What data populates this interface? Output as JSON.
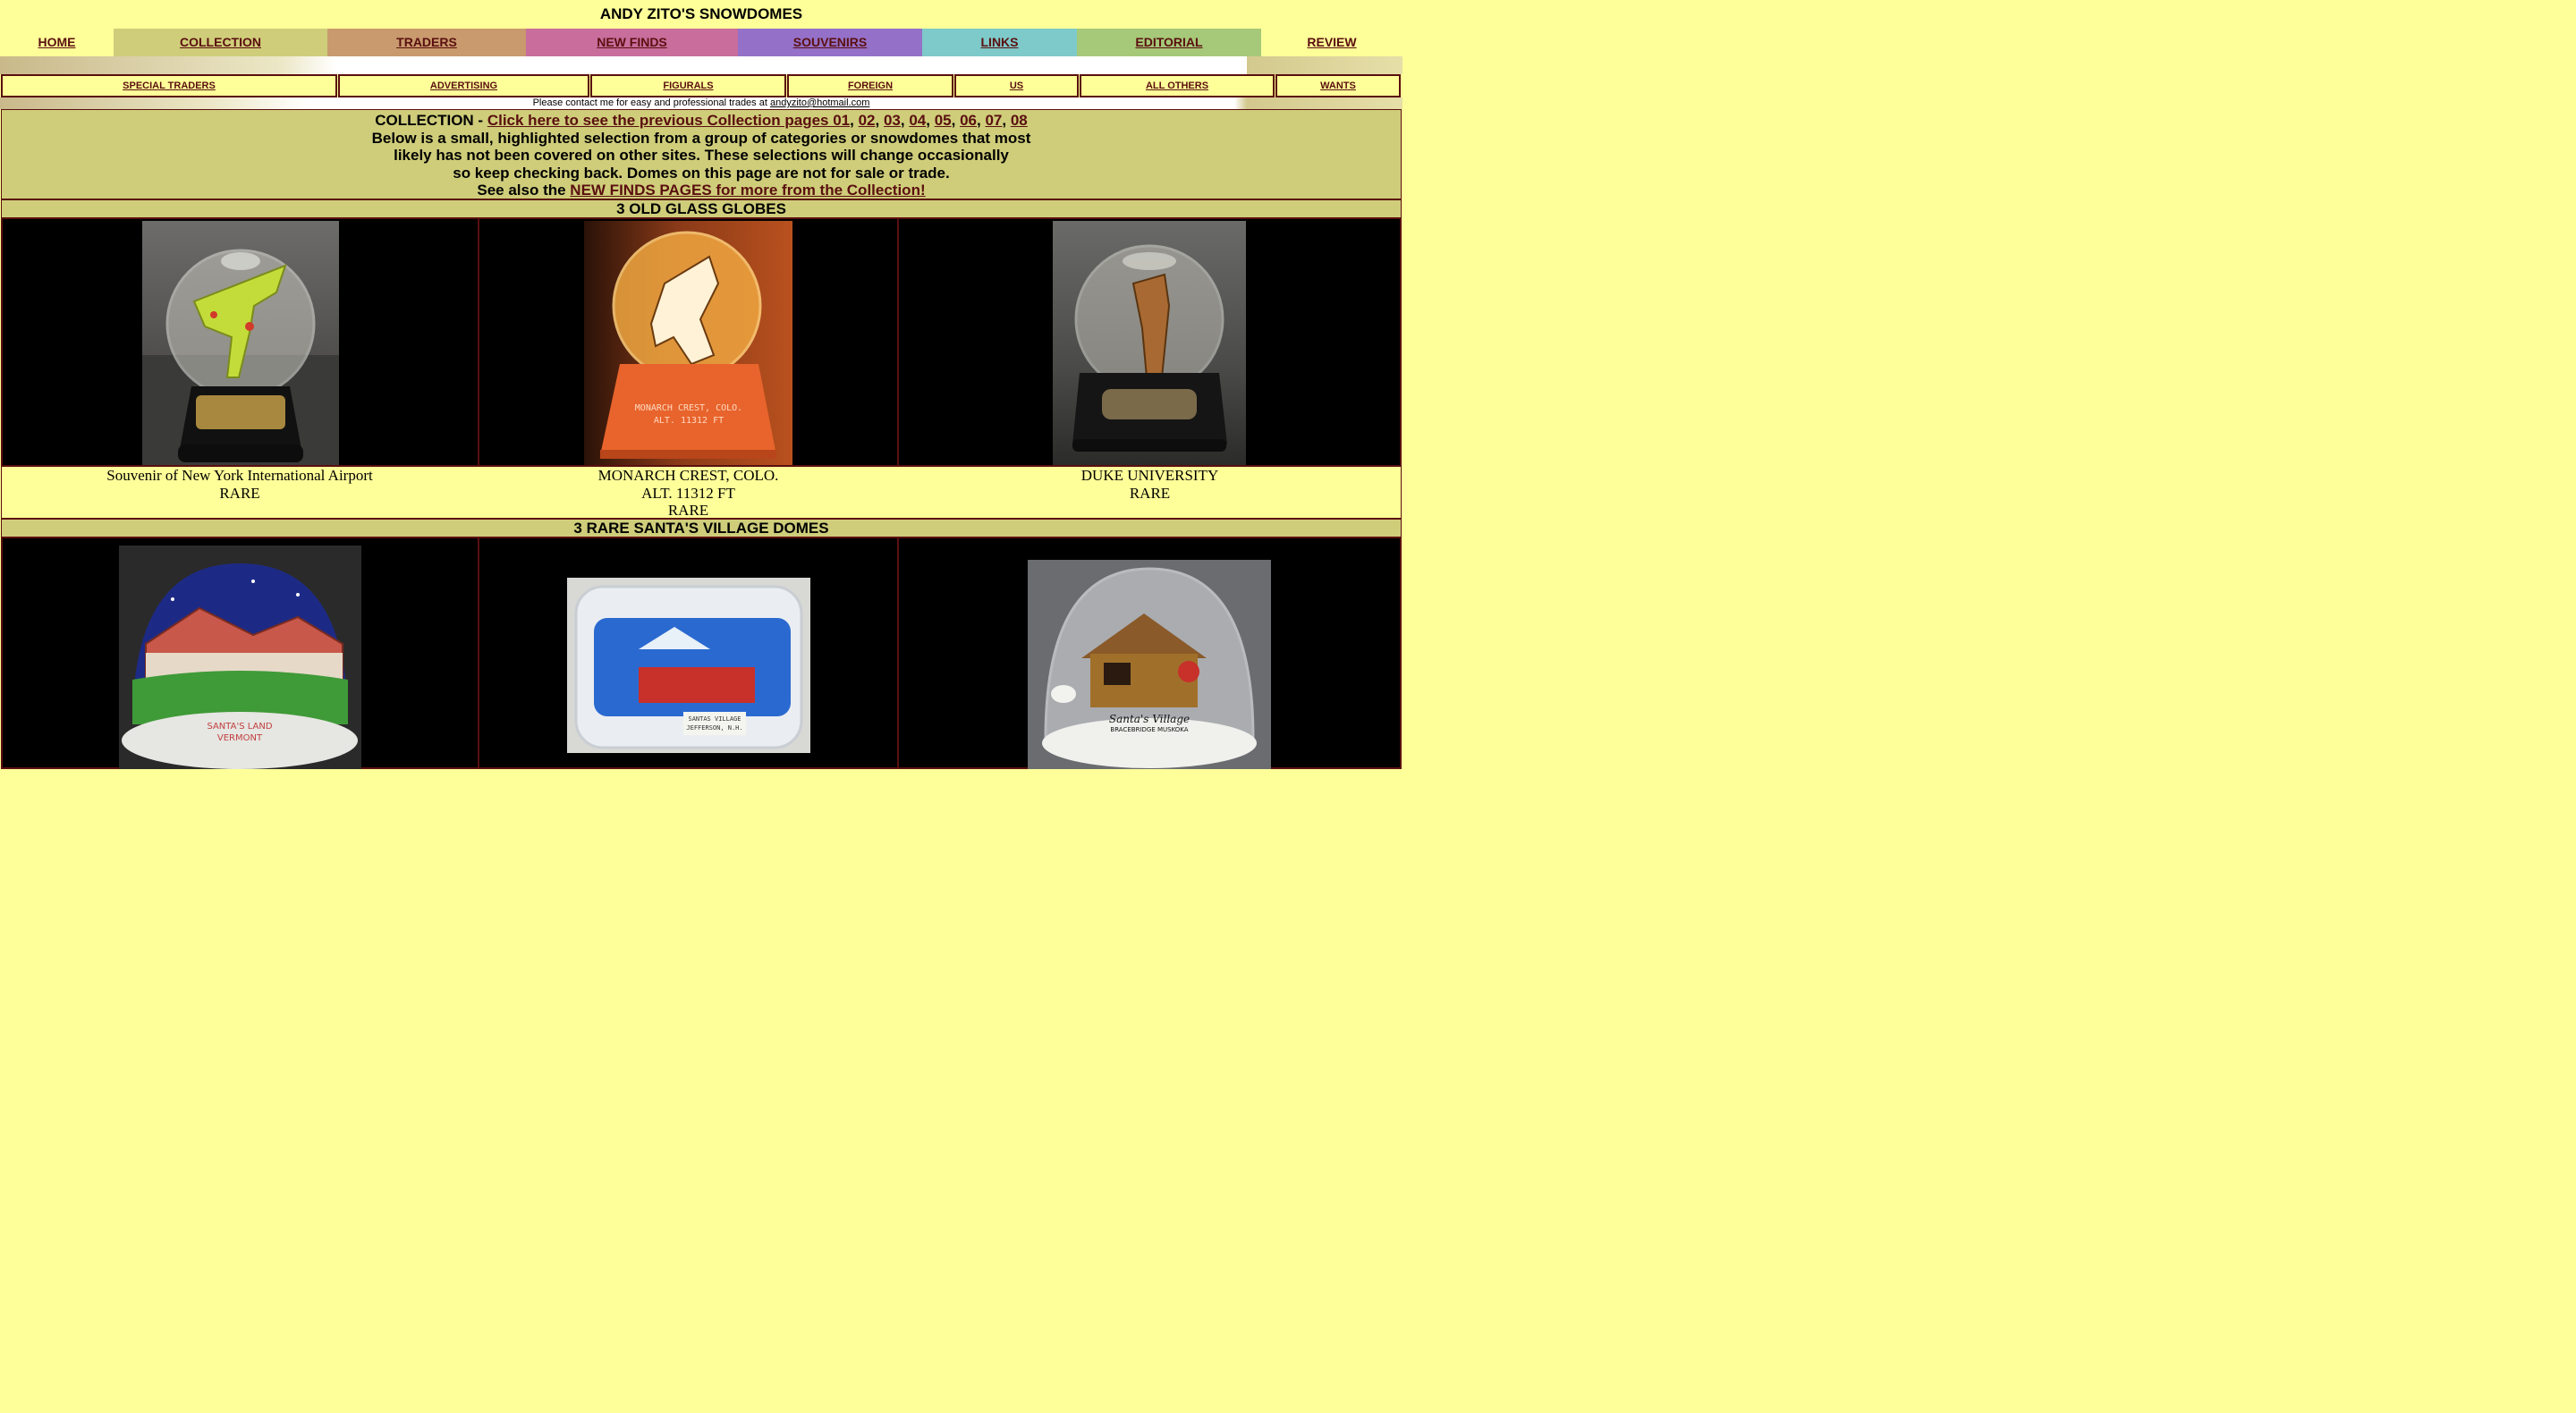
{
  "site": {
    "title": "ANDY ZITO'S SNOWDOMES"
  },
  "nav": [
    {
      "label": "HOME",
      "bg": "#ffff99"
    },
    {
      "label": "COLLECTION",
      "bg": "#cfcd7a"
    },
    {
      "label": "TRADERS",
      "bg": "#c89a6e"
    },
    {
      "label": "NEW FINDS",
      "bg": "#c86d9c"
    },
    {
      "label": "SOUVENIRS",
      "bg": "#9470c8"
    },
    {
      "label": "LINKS",
      "bg": "#7ec9c9"
    },
    {
      "label": "EDITORIAL",
      "bg": "#a6c979"
    },
    {
      "label": "REVIEW",
      "bg": "#ffff99"
    }
  ],
  "subnav": [
    "SPECIAL TRADERS",
    "ADVERTISING",
    "FIGURALS",
    "FOREIGN",
    "US",
    "ALL OTHERS",
    "WANTS"
  ],
  "contact": {
    "text": "Please contact me for easy and professional trades at ",
    "email": "andyzito@hotmail.com"
  },
  "intro": {
    "prefix": "COLLECTION - ",
    "link": "Click here to see the previous Collection pages 01",
    "pages": [
      "02",
      "03",
      "04",
      "05",
      "06",
      "07",
      "08"
    ],
    "line2": "Below is a small, highlighted selection from a group of categories or snowdomes that most",
    "line3": "likely has not been covered on other sites. These selections will change occasionally",
    "line4": "so keep checking back. Domes on this page are not for sale or trade.",
    "line5_prefix": "See also the ",
    "line5_link": "NEW FINDS PAGES for more from the Collection!"
  },
  "section1": {
    "title": "3 OLD GLASS GLOBES",
    "captions": [
      [
        "Souvenir of New York International Airport",
        "RARE"
      ],
      [
        "MONARCH CREST, COLO.",
        "ALT. 11312 FT",
        "RARE"
      ],
      [
        "DUKE UNIVERSITY",
        "RARE"
      ]
    ],
    "photo_labels": [
      "",
      "MONARCH CREST, COLO.|ALT. 11312 FT",
      "DUKE UNIVERSITY"
    ]
  },
  "section2": {
    "title": "3 RARE SANTA'S VILLAGE DOMES",
    "photo_labels": [
      "SANTA'S LAND|VERMONT",
      "SANTAS VILLAGE|JEFFERSON, N.H.",
      "Santa's Village|BRACEBRIDGE MUSKOKA"
    ]
  },
  "colors": {
    "maroon": "#5a0f0f",
    "page_bg": "#ffff99",
    "olive": "#cfcd7a"
  }
}
